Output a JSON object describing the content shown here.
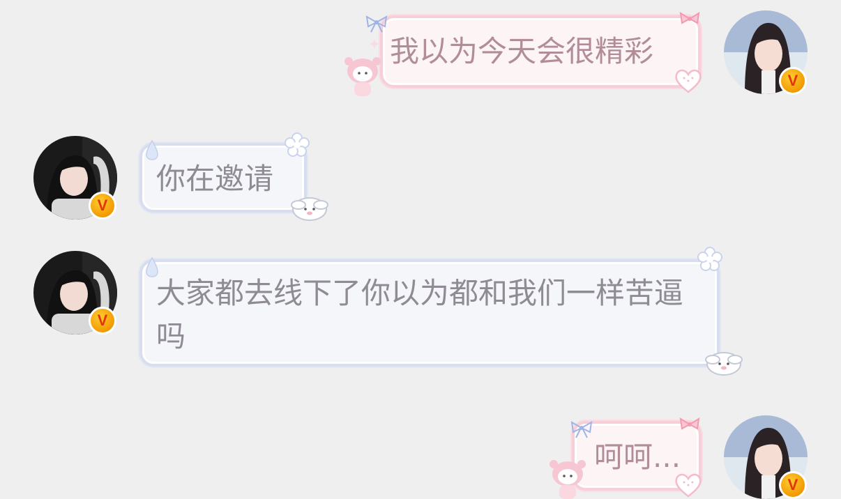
{
  "messages": [
    {
      "sender": "self",
      "text": "我以为今天会很精彩"
    },
    {
      "sender": "other",
      "text": "你在邀请"
    },
    {
      "sender": "other",
      "text": "大家都去线下了你以为都和我们一样苦逼吗"
    },
    {
      "sender": "self",
      "text": "呵呵..."
    }
  ],
  "badge": {
    "glyph": "V"
  },
  "colors": {
    "background": "#efefef",
    "pink_bubble_border": "#f6cfd8",
    "blue_bubble_border": "#d8def0",
    "badge": "#f29a00"
  }
}
